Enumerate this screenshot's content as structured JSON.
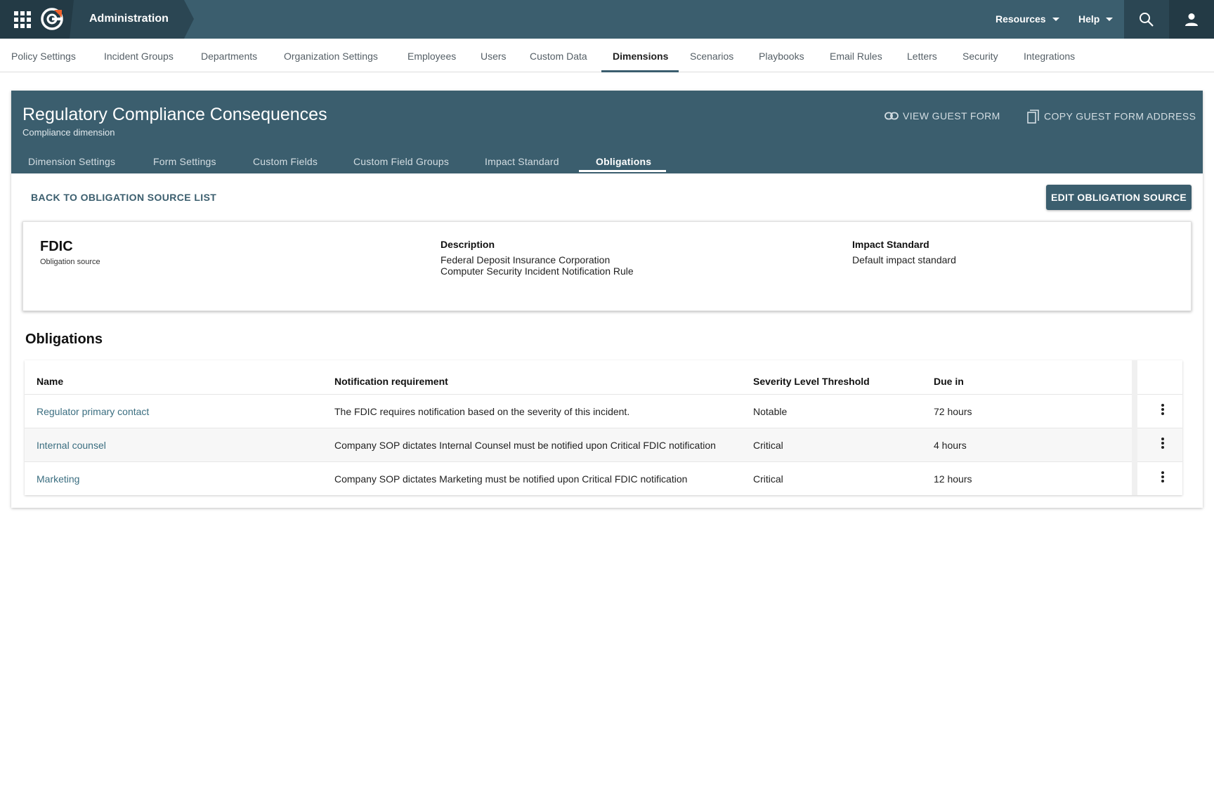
{
  "topbar": {
    "title": "Administration",
    "menus": [
      {
        "label": "Resources"
      },
      {
        "label": "Help"
      }
    ]
  },
  "admin_nav": {
    "items": [
      {
        "label": "Policy Settings"
      },
      {
        "label": "Incident Groups"
      },
      {
        "label": "Departments"
      },
      {
        "label": "Organization Settings"
      },
      {
        "label": "Employees"
      },
      {
        "label": "Users"
      },
      {
        "label": "Custom Data"
      },
      {
        "label": "Dimensions"
      },
      {
        "label": "Scenarios"
      },
      {
        "label": "Playbooks"
      },
      {
        "label": "Email Rules"
      },
      {
        "label": "Letters"
      },
      {
        "label": "Security"
      },
      {
        "label": "Integrations"
      }
    ],
    "active": "Dimensions"
  },
  "dimension": {
    "title": "Regulatory Compliance Consequences",
    "subtitle": "Compliance dimension",
    "view_guest_form": "VIEW GUEST FORM",
    "copy_guest_form_address": "COPY GUEST FORM ADDRESS",
    "tabs": [
      {
        "label": "Dimension Settings"
      },
      {
        "label": "Form Settings"
      },
      {
        "label": "Custom Fields"
      },
      {
        "label": "Custom Field Groups"
      },
      {
        "label": "Impact Standard"
      },
      {
        "label": "Obligations"
      }
    ],
    "active_tab": "Obligations"
  },
  "actions": {
    "back": "BACK TO OBLIGATION SOURCE LIST",
    "edit": "EDIT OBLIGATION SOURCE"
  },
  "source": {
    "name": "FDIC",
    "type": "Obligation source",
    "description_label": "Description",
    "description_line1": "Federal Deposit Insurance Corporation",
    "description_line2": "Computer Security Incident Notification Rule",
    "impact_label": "Impact Standard",
    "impact_value": "Default impact standard"
  },
  "obligations": {
    "title": "Obligations",
    "columns": [
      "Name",
      "Notification requirement",
      "Severity Level Threshold",
      "Due in"
    ],
    "rows": [
      {
        "name": "Regulator primary contact",
        "requirement": "The FDIC requires notification based on the severity of this incident.",
        "severity": "Notable",
        "due": "72 hours"
      },
      {
        "name": "Internal counsel",
        "requirement": "Company SOP dictates Internal Counsel must be notified upon Critical FDIC notification",
        "severity": "Critical",
        "due": "4 hours"
      },
      {
        "name": "Marketing",
        "requirement": "Company SOP dictates Marketing must be notified upon Critical FDIC notification",
        "severity": "Critical",
        "due": "12 hours"
      }
    ]
  },
  "colors": {
    "brand": "#3b5e6e",
    "brand_dark": "#2b4653",
    "accent_orange": "#f0622c",
    "link": "#3b6e80"
  }
}
